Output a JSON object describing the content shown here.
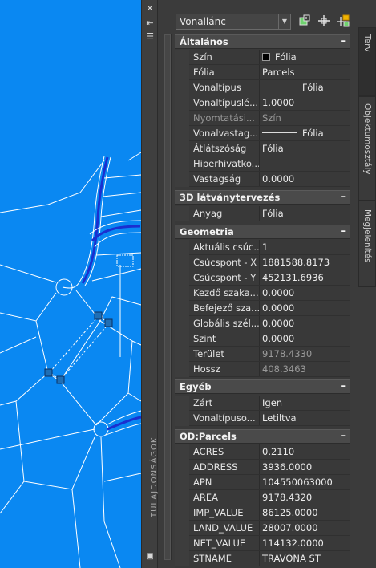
{
  "toolbar": {
    "object_type": "Vonallánc",
    "icons": [
      "quick-select-icon",
      "pick-add-icon",
      "select-objects-icon"
    ]
  },
  "left_strip": {
    "title": "TULAJDONSÁGOK",
    "icons": [
      "close-icon",
      "auto-hide-icon",
      "options-icon"
    ]
  },
  "side_tabs": [
    "Terv",
    "Objektumosztály",
    "Megjelenítés"
  ],
  "sections": [
    {
      "title": "Általános",
      "toggle": "–",
      "rows": [
        {
          "label": "Szín",
          "value": "Fólia"
        },
        {
          "label": "Fólia",
          "value": "Parcels"
        },
        {
          "label": "Vonaltípus",
          "value": "Fólia"
        },
        {
          "label": "Vonaltípuslé...",
          "value": "1.0000"
        },
        {
          "label": "Nyomtatási...",
          "value": "Szín"
        },
        {
          "label": "Vonalvastag...",
          "value": "Fólia"
        },
        {
          "label": "Átlátszóság",
          "value": "Fólia"
        },
        {
          "label": "Hiperhivatko...",
          "value": ""
        },
        {
          "label": "Vastagság",
          "value": "0.0000"
        }
      ]
    },
    {
      "title": "3D látványtervezés",
      "toggle": "–",
      "rows": [
        {
          "label": "Anyag",
          "value": "Fólia"
        }
      ]
    },
    {
      "title": "Geometria",
      "toggle": "–",
      "rows": [
        {
          "label": "Aktuális csúc...",
          "value": "1"
        },
        {
          "label": "Csúcspont - X",
          "value": "1881588.8173"
        },
        {
          "label": "Csúcspont - Y",
          "value": "452131.6936"
        },
        {
          "label": "Kezdő szaka...",
          "value": "0.0000"
        },
        {
          "label": "Befejező sza...",
          "value": "0.0000"
        },
        {
          "label": "Globális szél...",
          "value": "0.0000"
        },
        {
          "label": "Szint",
          "value": "0.0000"
        },
        {
          "label": "Terület",
          "value": "9178.4330"
        },
        {
          "label": "Hossz",
          "value": "408.3463"
        }
      ]
    },
    {
      "title": "Egyéb",
      "toggle": "–",
      "rows": [
        {
          "label": "Zárt",
          "value": "Igen"
        },
        {
          "label": "Vonaltípuso...",
          "value": "Letiltva"
        }
      ]
    },
    {
      "title": "OD:Parcels",
      "toggle": "–",
      "rows": [
        {
          "label": "ACRES",
          "value": "0.2110"
        },
        {
          "label": "ADDRESS",
          "value": "3936.0000"
        },
        {
          "label": "APN",
          "value": "104550063000"
        },
        {
          "label": "AREA",
          "value": "9178.4320"
        },
        {
          "label": "IMP_VALUE",
          "value": "86125.0000"
        },
        {
          "label": "LAND_VALUE",
          "value": "28007.0000"
        },
        {
          "label": "NET_VALUE",
          "value": "114132.0000"
        },
        {
          "label": "STNAME",
          "value": "TRAVONA ST"
        }
      ]
    }
  ],
  "colors": {
    "canvas_background": "#0a88f2",
    "parcel_lines": "#ffffff",
    "road_highlight": "#1a2fd0",
    "grip": "#1f6fb5"
  }
}
